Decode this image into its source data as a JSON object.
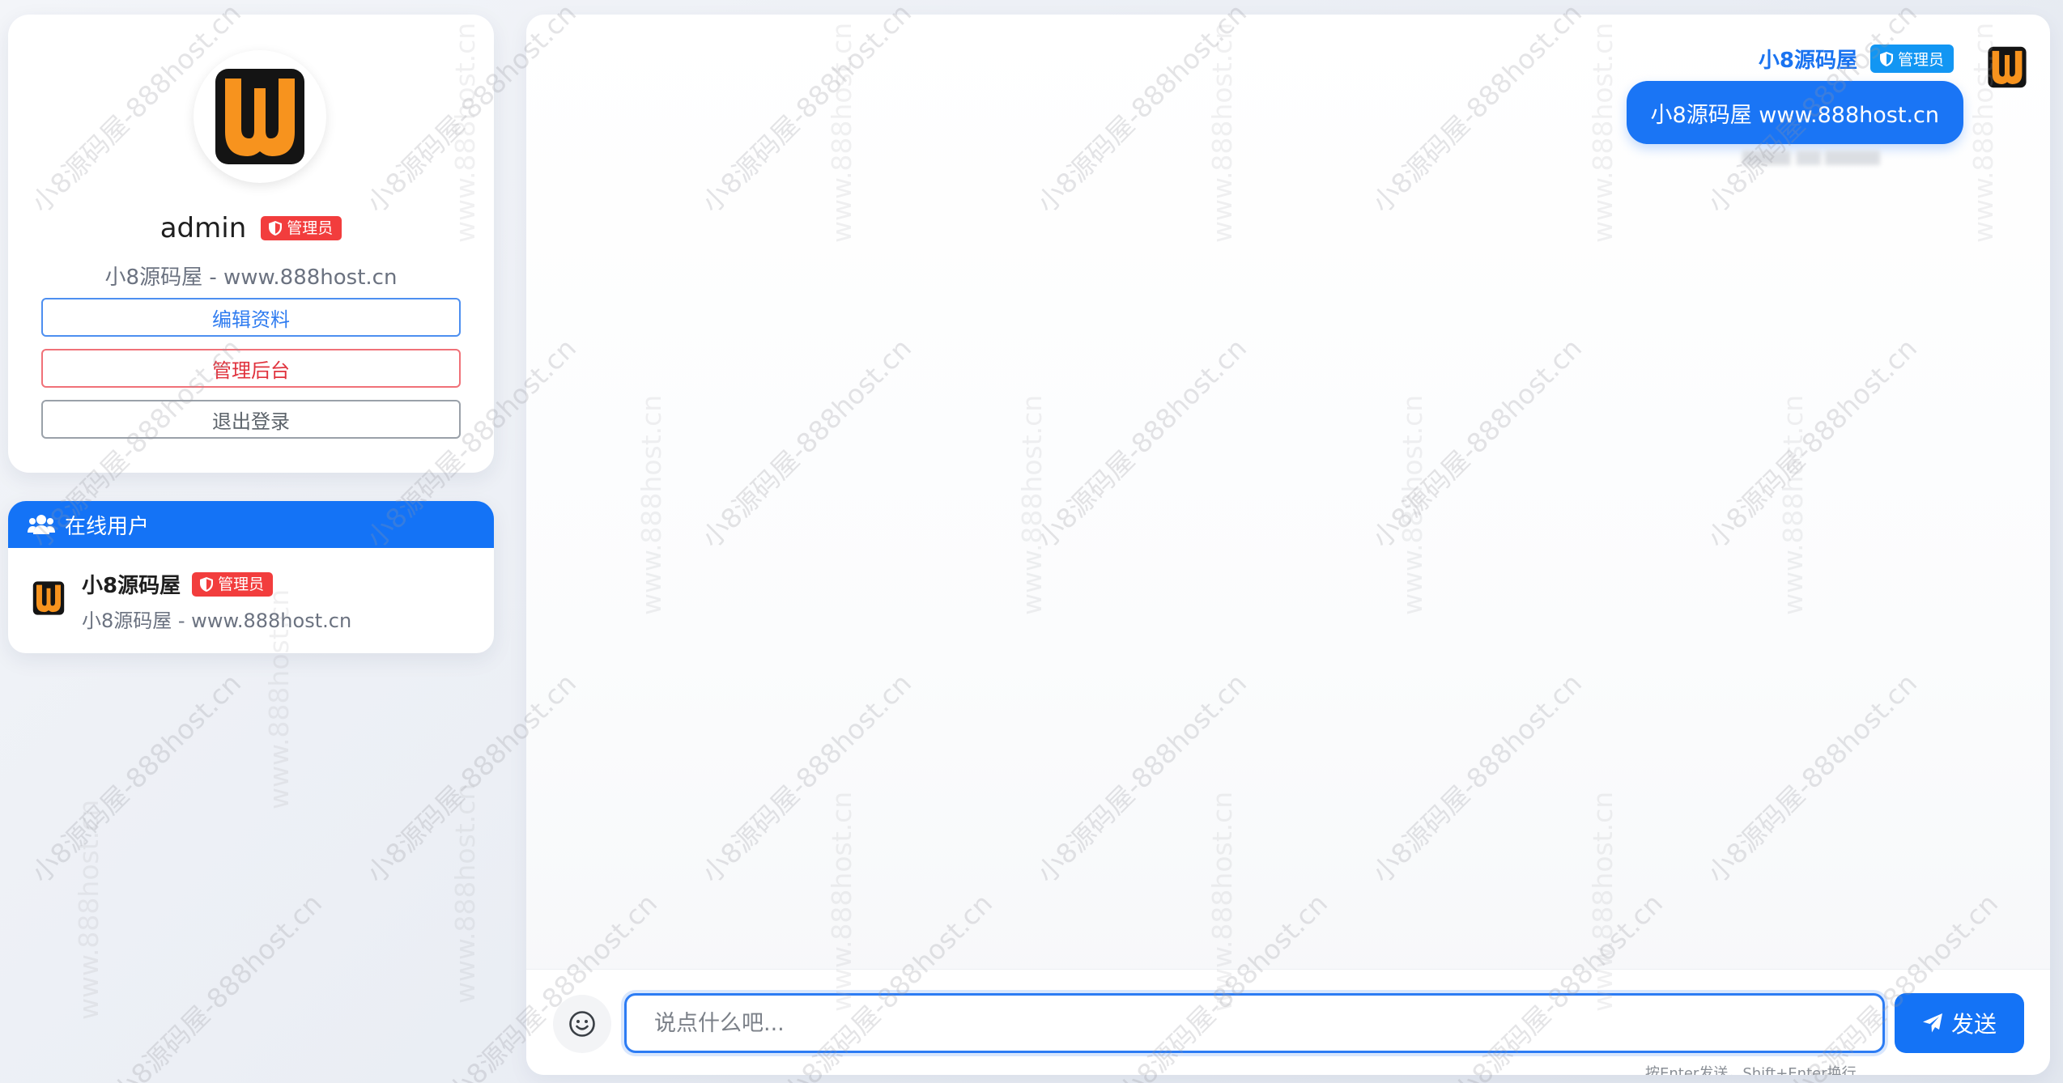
{
  "profile": {
    "name": "admin",
    "role_badge": "管理员",
    "subtitle": "小8源码屋 - www.888host.cn",
    "edit_label": "编辑资料",
    "admin_label": "管理后台",
    "logout_label": "退出登录"
  },
  "online": {
    "title": "在线用户",
    "users": [
      {
        "name": "小8源码屋",
        "badge": "管理员",
        "subtitle": "小8源码屋 - www.888host.cn"
      }
    ]
  },
  "chat": {
    "messages": [
      {
        "sender": "小8源码屋",
        "badge": "管理员",
        "text": "小8源码屋 www.888host.cn"
      }
    ],
    "input_placeholder": "说点什么吧...",
    "send_label": "发送",
    "hint": "按Enter发送，Shift+Enter换行"
  },
  "watermark": {
    "diagonal": "小8源码屋-888host.cn",
    "vertical": "www.888host.cn"
  },
  "colors": {
    "primary": "#1473f6",
    "danger": "#f23d3d",
    "badge_blue": "#1296f3",
    "logo_orange": "#f7931e"
  }
}
